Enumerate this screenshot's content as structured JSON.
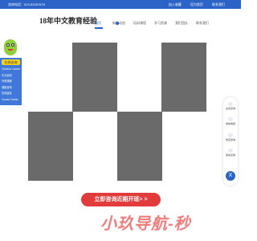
{
  "topbar": {
    "contact": "咨询电话：023-52287878",
    "links": [
      "加入收藏",
      "设为首页",
      "联系我们"
    ]
  },
  "header": {
    "site_title": "18年中文教育经验"
  },
  "nav": {
    "items": [
      "首页",
      "新闻动态",
      "培训课程",
      "学习资源",
      "我们团队",
      "联系我们"
    ],
    "active_index": 0
  },
  "sidebar_left": {
    "header": "在线咨询",
    "items": [
      "Chinese Course",
      "中文培训",
      "外语课程",
      "课程咨询",
      "在线留言",
      "Course Center"
    ]
  },
  "sidebar_right": {
    "items": [
      "在线咨询",
      "微信客服",
      "电话咨询",
      "留言咨询"
    ],
    "close_symbol": "X"
  },
  "cta": {
    "label": "立即咨询近期开班> >"
  },
  "watermark": {
    "text": "小玖导航-秒"
  },
  "colors": {
    "brand_blue": "#2b63c6",
    "cta_red": "#e23b3b",
    "placeholder_gray": "#6a6a6a",
    "left_panel_blue": "#3f78d8",
    "left_panel_header": "#f5d31c"
  }
}
